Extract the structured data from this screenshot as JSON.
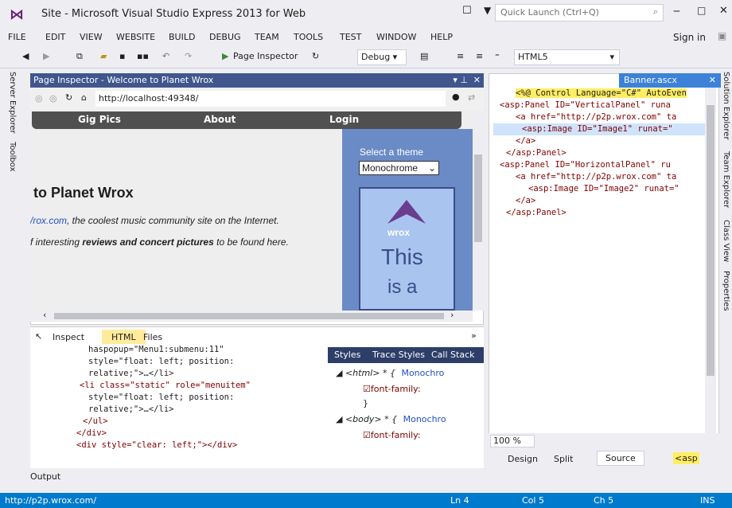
{
  "window": {
    "title": "Site - Microsoft Visual Studio Express 2013 for Web",
    "quick_launch": "Quick Launch (Ctrl+Q)",
    "sign_in": "Sign in"
  },
  "menu": [
    "FILE",
    "EDIT",
    "VIEW",
    "WEBSITE",
    "BUILD",
    "DEBUG",
    "TEAM",
    "TOOLS",
    "TEST",
    "WINDOW",
    "HELP"
  ],
  "toolbar": {
    "page_inspector": "Page Inspector",
    "config": "Debug",
    "schema": "HTML5"
  },
  "side_left": {
    "server_explorer": "Server Explorer",
    "toolbox": "Toolbox"
  },
  "side_right": {
    "solution_explorer": "Solution Explorer",
    "team_explorer": "Team Explorer",
    "class_view": "Class View",
    "properties": "Properties"
  },
  "page_inspector": {
    "title": "Page Inspector - Welcome to Planet Wrox",
    "url": "http://localhost:49348/",
    "nav": [
      "Gig Pics",
      "About",
      "Login"
    ],
    "heading": "to Planet Wrox",
    "line1_link": "/rox.com",
    "line1_rest": ", the coolest music community site on the Internet.",
    "line2_a": "f interesting ",
    "line2_b": "reviews and concert pictures",
    "line2_c": " to be found here.",
    "theme_label": "Select a theme",
    "theme_value": "Monochrome",
    "logo": "wrox",
    "preview_text1": "This",
    "preview_text2": "is a"
  },
  "bottom": {
    "inspect": "Inspect",
    "tab_html": "HTML",
    "tab_files": "Files",
    "code": [
      "haspopup=\"Menu1:submenu:11\"",
      "style=\"float: left; position:",
      "relative;\">…</li>",
      "<li class=\"static\" role=\"menuitem\"",
      "style=\"float: left; position:",
      "relative;\">…</li>",
      "</ul>",
      "</div>",
      "<div style=\"clear: left;\"></div>"
    ]
  },
  "styles": {
    "tabs": [
      "Styles",
      "Trace Styles",
      "Call Stack"
    ],
    "rule1_sel": "<html> * {",
    "rule1_src": "Monochro",
    "prop": "font-family:",
    "close": "}",
    "rule2_sel": "<body> * {",
    "rule2_src": "Monochro"
  },
  "editor": {
    "tab": "Banner.ascx",
    "lines": [
      "<%@ Control Language=\"C#\" AutoEven",
      "<asp:Panel ID=\"VerticalPanel\" runa",
      "<a href=\"http://p2p.wrox.com\" ta",
      "<asp:Image ID=\"Image1\" runat=\"",
      "</a>",
      "</asp:Panel>",
      "<asp:Panel ID=\"HorizontalPanel\" ru",
      "<a href=\"http://p2p.wrox.com\" ta",
      "<asp:Image ID=\"Image2\" runat=\"",
      "</a>",
      "</asp:Panel>"
    ],
    "zoom": "100 %",
    "design": "Design",
    "split": "Split",
    "source": "Source",
    "crumb": "<asp"
  },
  "output": "Output",
  "status": {
    "url": "http://p2p.wrox.com/",
    "ln": "Ln 4",
    "col": "Col 5",
    "ch": "Ch 5",
    "mode": "INS"
  },
  "colors": {
    "accent": "#007acc",
    "panel_title": "#40568d",
    "theme_bg": "#6b8bc6"
  }
}
